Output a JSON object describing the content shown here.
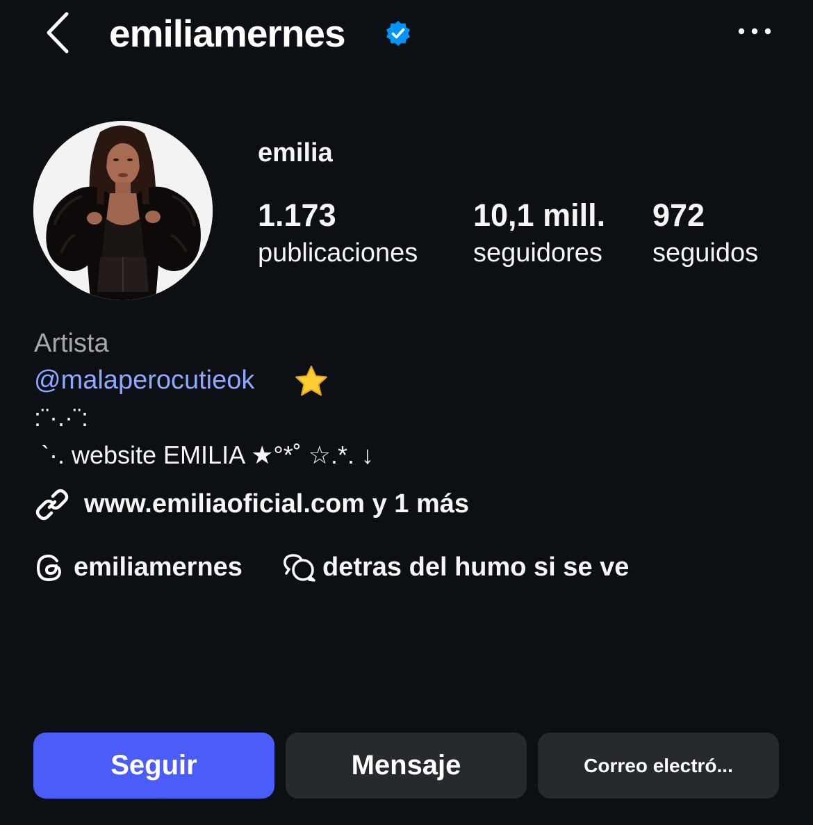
{
  "header": {
    "username": "emiliamernes",
    "back_icon": "chevron-left-icon",
    "verified_icon": "verified-badge-icon",
    "more_icon": "more-horizontal-icon"
  },
  "profile": {
    "display_name": "emilia",
    "avatar_icon": "profile-photo",
    "stats": [
      {
        "value": "1.173",
        "label": "publicaciones"
      },
      {
        "value": "10,1 mill.",
        "label": "seguidores"
      },
      {
        "value": "972",
        "label": "seguidos"
      }
    ]
  },
  "bio": {
    "category": "Artista",
    "mention": "@malaperocutieok",
    "mention_emoji": "star-emoji",
    "line1": ":¨·.·¨:",
    "line2": " `·. website EMILIA ★°*˚ ☆.*. ↓",
    "link": "www.emiliaoficial.com y 1 más",
    "threads_handle": "emiliamernes",
    "note": "detras del humo si se ve"
  },
  "actions": {
    "follow": "Seguir",
    "message": "Mensaje",
    "email": "Correo electró..."
  },
  "colors": {
    "background": "#0c1014",
    "accent": "#4a5df9",
    "secondary_button": "#262a2f",
    "mention": "#8fa8ff",
    "verified": "#0095f6"
  }
}
